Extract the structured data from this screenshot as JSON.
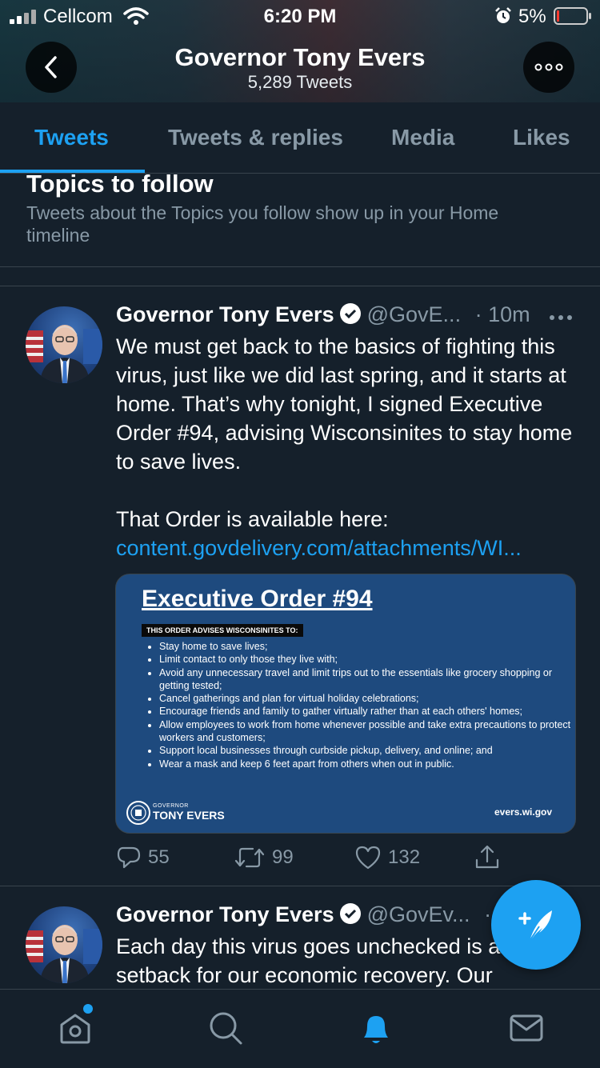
{
  "status_bar": {
    "carrier": "Cellcom",
    "time": "6:20 PM",
    "battery": "5%"
  },
  "header": {
    "title": "Governor Tony Evers",
    "subtitle": "5,289 Tweets"
  },
  "tabs": [
    {
      "label": "Tweets",
      "active": true
    },
    {
      "label": "Tweets & replies",
      "active": false
    },
    {
      "label": "Media",
      "active": false
    },
    {
      "label": "Likes",
      "active": false
    }
  ],
  "topics": {
    "title": "Topics to follow",
    "description": "Tweets about the Topics you follow show up in your Home timeline"
  },
  "tweets": [
    {
      "name": "Governor Tony Evers",
      "handle": "@GovE...",
      "time": "· 10m",
      "text": "We must get back to the basics of fighting this virus, just like we did last spring, and it starts at home. That’s why tonight, I signed Executive Order #94, advising Wisconsinites to stay home to save lives.",
      "text2": "That Order is available here:",
      "link": "content.govdelivery.com/attachments/WI...",
      "card": {
        "title": "Executive Order #94",
        "subtitle": "THIS ORDER ADVISES WISCONSINITES TO:",
        "items": [
          "Stay home to save lives;",
          "Limit contact to only those they live with;",
          "Avoid any unnecessary travel and limit trips out to the essentials like grocery shopping or getting tested;",
          "Cancel gatherings and plan for virtual holiday celebrations;",
          "Encourage friends and family to gather virtually rather than at each others' homes;",
          "Allow employees to work from home whenever possible and take extra precautions to protect workers and customers;",
          "Support local businesses through curbside pickup, delivery, and online; and",
          "Wear a mask and keep 6 feet apart from others when out in public."
        ],
        "logo_small": "GOVERNOR",
        "logo_name": "TONY EVERS",
        "url": "evers.wi.gov"
      },
      "replies": "55",
      "retweets": "99",
      "likes": "132"
    },
    {
      "name": "Governor Tony Evers",
      "handle": "@GovEv...",
      "time": "·",
      "text": "Each day this virus goes unchecked is a setback for our economic recovery. Our"
    }
  ],
  "colors": {
    "background": "#15202b",
    "accent": "#1da1f2",
    "muted": "#8899a6",
    "divider": "#38444d"
  },
  "icons": {
    "tabbar": [
      "home-icon",
      "search-icon",
      "notifications-bell-icon",
      "messages-mail-icon"
    ],
    "actions": [
      "reply-icon",
      "retweet-icon",
      "like-heart-icon",
      "share-icon"
    ]
  }
}
